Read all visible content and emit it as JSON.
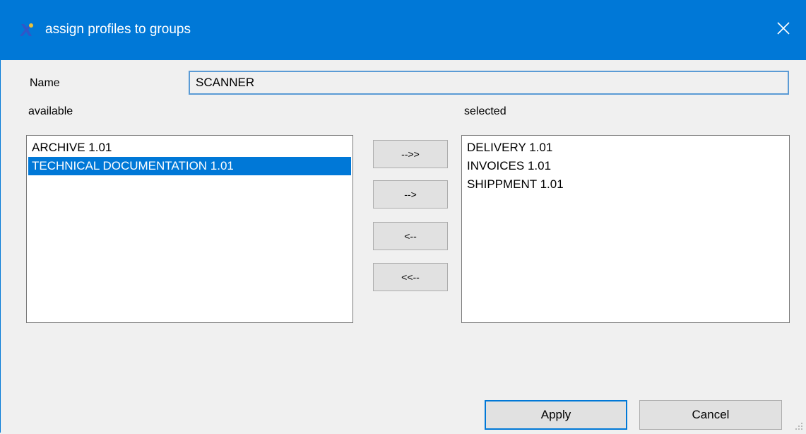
{
  "window": {
    "title": "assign profiles to groups"
  },
  "form": {
    "name_label": "Name",
    "name_value": "SCANNER",
    "available_label": "available",
    "selected_label": "selected"
  },
  "available_items": [
    {
      "label": "ARCHIVE 1.01",
      "selected": false
    },
    {
      "label": "TECHNICAL DOCUMENTATION 1.01",
      "selected": true
    }
  ],
  "selected_items": [
    {
      "label": "DELIVERY 1.01"
    },
    {
      "label": "INVOICES 1.01"
    },
    {
      "label": "SHIPPMENT 1.01"
    }
  ],
  "transfer_buttons": {
    "add_all": "-->>",
    "add": "-->",
    "remove": "<--",
    "remove_all": "<<--"
  },
  "footer": {
    "apply_label": "Apply",
    "cancel_label": "Cancel"
  },
  "colors": {
    "accent": "#0078d7",
    "selection": "#0078d7",
    "background": "#f0f0f0"
  },
  "icons": {
    "app": "profiles-app-icon",
    "close": "close-icon",
    "resize": "resize-grip-icon"
  }
}
